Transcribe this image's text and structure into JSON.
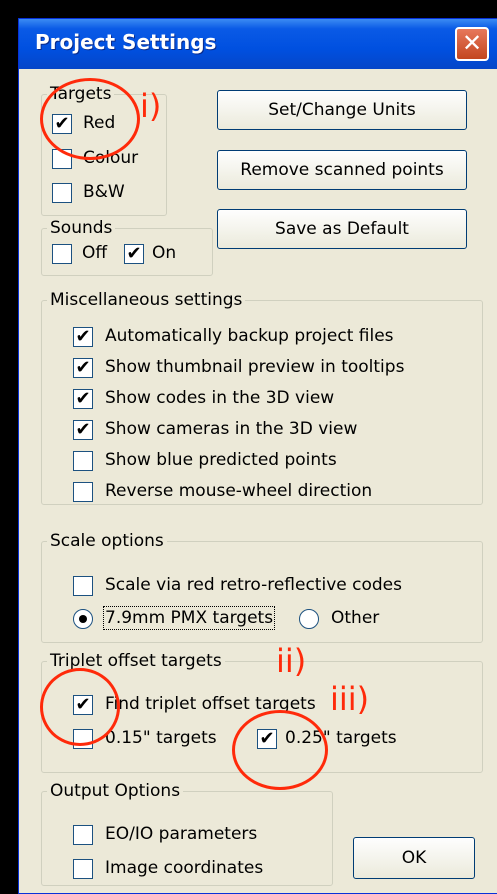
{
  "window": {
    "title": "Project Settings",
    "close_glyph": "✕"
  },
  "targets": {
    "legend": "Targets",
    "red": {
      "label": "Red",
      "checked": true
    },
    "colour": {
      "label": "Colour",
      "checked": false
    },
    "bw": {
      "label": "B&W",
      "checked": false
    }
  },
  "buttons": {
    "set_units": "Set/Change Units",
    "remove_points": "Remove scanned points",
    "save_default": "Save as Default",
    "ok": "OK"
  },
  "sounds": {
    "legend": "Sounds",
    "off": {
      "label": "Off",
      "checked": false
    },
    "on": {
      "label": "On",
      "checked": true
    }
  },
  "misc": {
    "legend": "Miscellaneous settings",
    "items": [
      {
        "label": "Automatically backup project files",
        "checked": true
      },
      {
        "label": "Show thumbnail preview in tooltips",
        "checked": true
      },
      {
        "label": "Show codes in the 3D view",
        "checked": true
      },
      {
        "label": "Show cameras in the 3D view",
        "checked": true
      },
      {
        "label": "Show blue predicted points",
        "checked": false
      },
      {
        "label": "Reverse mouse-wheel direction",
        "checked": false
      }
    ]
  },
  "scale": {
    "legend": "Scale options",
    "scale_codes": {
      "label": "Scale via red retro-reflective codes",
      "checked": false
    },
    "pmx": {
      "label": "7.9mm PMX targets",
      "selected": true
    },
    "other": {
      "label": "Other",
      "selected": false
    }
  },
  "triplet": {
    "legend": "Triplet offset targets",
    "find": {
      "label": "Find triplet offset targets",
      "checked": true
    },
    "t015": {
      "label": "0.15\" targets",
      "checked": false
    },
    "t025": {
      "label": "0.25\" targets",
      "checked": true
    }
  },
  "output": {
    "legend": "Output Options",
    "eo_io": {
      "label": "EO/IO parameters",
      "checked": false
    },
    "image_coords": {
      "label": "Image coordinates",
      "checked": false
    }
  },
  "annotations": {
    "i": "i)",
    "ii": "ii)",
    "iii": "iii)",
    "color": "#ff2a0a"
  },
  "check_glyph": "✔"
}
